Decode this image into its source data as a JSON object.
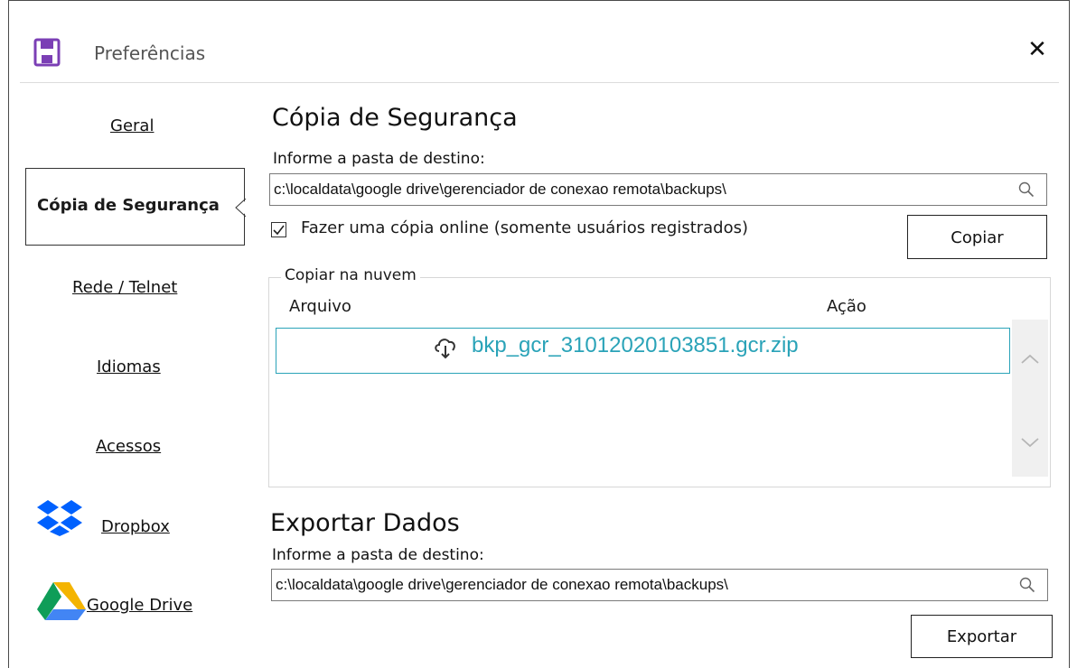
{
  "window": {
    "title": "Preferências",
    "close_label": "✕"
  },
  "sidebar": {
    "items": [
      {
        "label": "Geral"
      },
      {
        "label": "Cópia de Segurança"
      },
      {
        "label": "Rede / Telnet"
      },
      {
        "label": "Idiomas"
      },
      {
        "label": "Acessos"
      },
      {
        "label": "Dropbox"
      },
      {
        "label": "Google Drive"
      }
    ]
  },
  "backup": {
    "title": "Cópia de Segurança",
    "dest_label": "Informe a pasta de destino:",
    "dest_path": "c:\\localdata\\google drive\\gerenciador de conexao remota\\backups\\",
    "online_copy_label": "Fazer uma cópia online (somente usuários registrados)",
    "online_copy_checked": true,
    "copy_button": "Copiar"
  },
  "cloud": {
    "legend": "Copiar na nuvem",
    "columns": [
      "Arquivo",
      "Ação"
    ],
    "files": [
      "bkp_gcr_31012020103851.gcr.zip"
    ]
  },
  "export": {
    "title": "Exportar Dados",
    "dest_label": "Informe a pasta de destino:",
    "dest_path": "c:\\localdata\\google drive\\gerenciador de conexao remota\\backups\\",
    "export_button": "Exportar"
  },
  "colors": {
    "accent": "#2aa3b8",
    "app_icon": "#7b3fb5",
    "dropbox": "#0061fe"
  }
}
